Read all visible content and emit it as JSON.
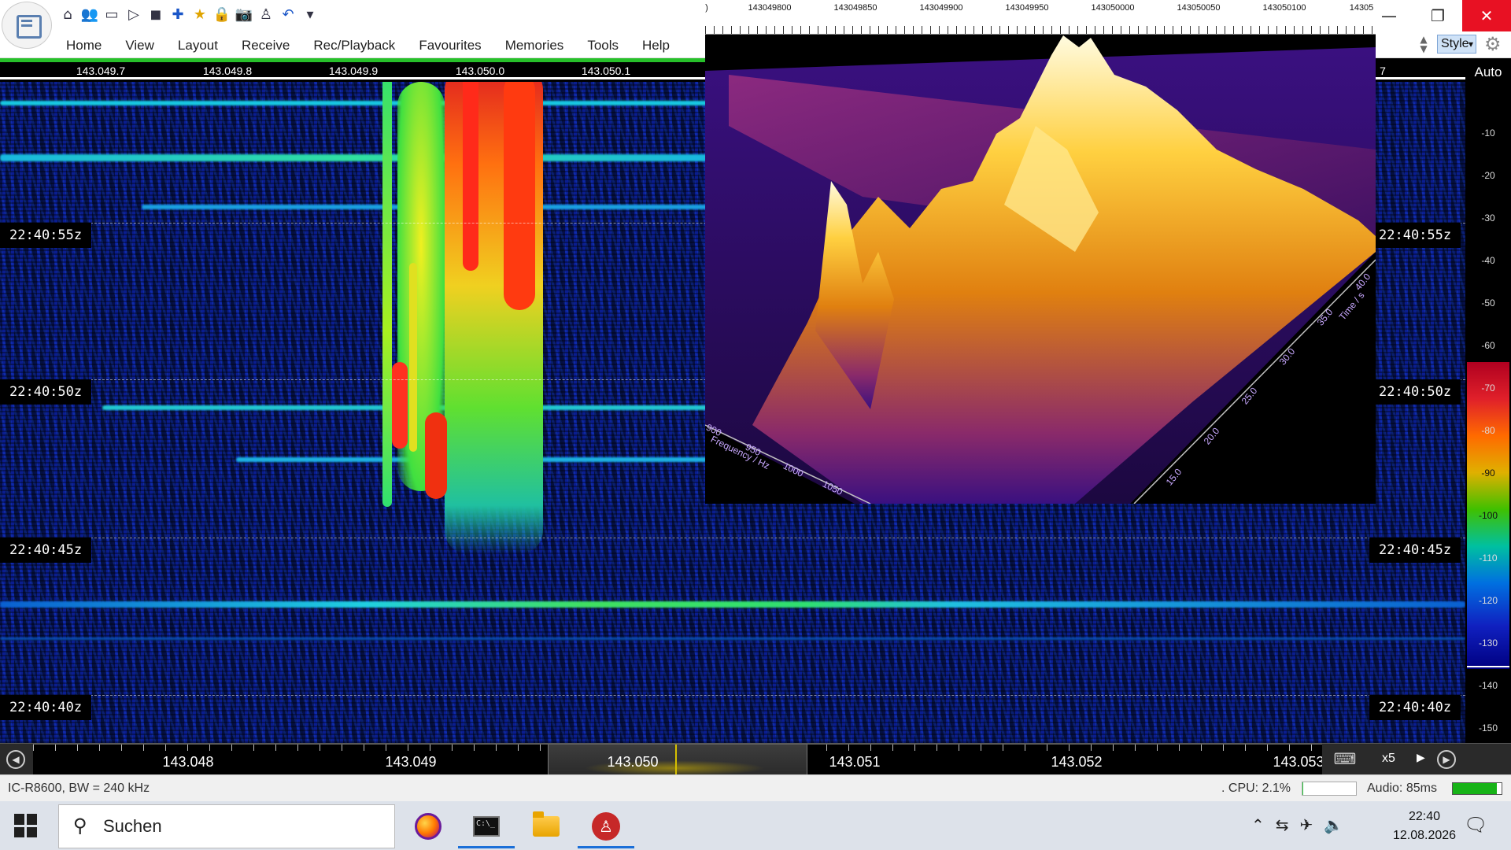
{
  "window": {
    "minimize_glyph": "—",
    "restore_glyph": "❐",
    "close_glyph": "✕"
  },
  "quick_access": [
    {
      "icon": "home-icon",
      "glyph": "⌂"
    },
    {
      "icon": "users-icon",
      "glyph": "👥"
    },
    {
      "icon": "folder-icon",
      "glyph": "▭"
    },
    {
      "icon": "play-icon",
      "glyph": "▷"
    },
    {
      "icon": "stop-icon",
      "glyph": "◼"
    },
    {
      "icon": "add-icon",
      "glyph": "✚"
    },
    {
      "icon": "star-icon",
      "glyph": "★"
    },
    {
      "icon": "lock-icon",
      "glyph": "🔒"
    },
    {
      "icon": "camera-icon",
      "glyph": "📷"
    },
    {
      "icon": "antenna-icon",
      "glyph": "♙"
    },
    {
      "icon": "undo-icon",
      "glyph": "↶"
    },
    {
      "icon": "more-icon",
      "glyph": "▾"
    }
  ],
  "menu": [
    "Home",
    "View",
    "Layout",
    "Receive",
    "Rec/Playback",
    "Favourites",
    "Memories",
    "Tools",
    "Help"
  ],
  "style_label": "Style",
  "top_freq_labels": [
    "143.049.7",
    "143.049.8",
    "143.049.9",
    "143.050.0",
    "143.050.1",
    "7"
  ],
  "plot3d": {
    "axis_ticks": [
      ")",
      "143049800",
      "143049850",
      "143049900",
      "143049950",
      "143050000",
      "143050050",
      "143050100",
      "14305"
    ],
    "freq_axis_label": "Frequency / Hz",
    "freq_ticks": [
      "900",
      "950",
      "1000",
      "1050"
    ],
    "time_axis_label": "Time / s",
    "time_ticks": [
      "15.0",
      "20.0",
      "25.0",
      "30.0",
      "35.0",
      "40.0"
    ]
  },
  "level_scale": {
    "mode": "Auto",
    "ticks": [
      "-10",
      "-20",
      "-30",
      "-40",
      "-50",
      "-60",
      "-70",
      "-80",
      "-90",
      "-100",
      "-110",
      "-120",
      "-130",
      "-140",
      "-150"
    ]
  },
  "time_markers": [
    "22:40:55z",
    "22:40:50z",
    "22:40:45z",
    "22:40:40z"
  ],
  "freq_bar": {
    "labels": [
      "143.048",
      "143.049",
      "143.050",
      "143.051",
      "143.052",
      "143.053"
    ],
    "zoom": "x5",
    "keyboard_icon": "⌨"
  },
  "status": {
    "device": "IC-R8600, BW = 240 kHz",
    "cpu": ". CPU: 2.1%",
    "cpu_fraction": 0.021,
    "audio": "Audio: 85ms",
    "audio_fraction": 0.9
  },
  "taskbar": {
    "search_placeholder": "Suchen",
    "time": "22:40",
    "date": "12.08.2026",
    "tray_icons": [
      "⌃",
      "⇆",
      "✈",
      "🔈"
    ]
  }
}
